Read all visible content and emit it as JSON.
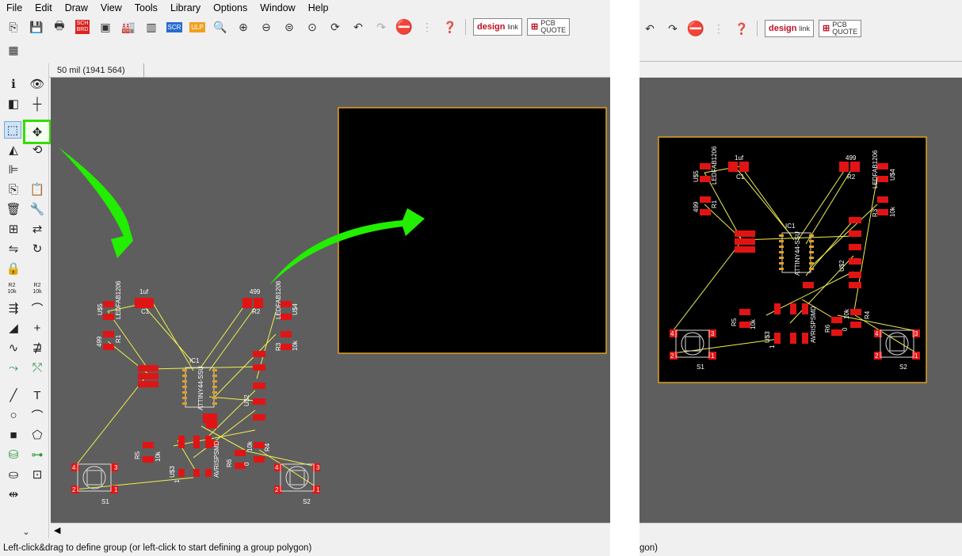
{
  "menu": [
    "File",
    "Edit",
    "Draw",
    "View",
    "Tools",
    "Library",
    "Options",
    "Window",
    "Help"
  ],
  "coordinate_readout": "50 mil (1941 564)",
  "status_text": "Left-click&drag to define group (or left-click to start defining a group polygon)",
  "status_text_right": "gon)",
  "logos": {
    "designlink": [
      "design",
      "link"
    ],
    "pcbquote": [
      "PCB",
      "QUOTE"
    ]
  },
  "toolbar_badges": {
    "sch_brd": "SCH BRD",
    "scr": "SCR",
    "ulp": "ULP"
  },
  "colors": {
    "canvas": "#5e5e5e",
    "board": "#000000",
    "outline": "#e0a020",
    "pad": "#e11414",
    "airwire": "#f0f050",
    "arrow": "#22ee00",
    "highlight": "#33dd00"
  },
  "side_labels": {
    "r2": "R2",
    "r2val": "10k"
  },
  "pcb": {
    "labels": {
      "u5": "U$5",
      "led1": "LEDFAB1206",
      "c1": "C1",
      "c1v": "1uf",
      "r1v": "499",
      "r1": "R1",
      "r2v": "499",
      "r2": "R2",
      "led2": "LEDFAB1206",
      "u4": "U$4",
      "r3": "R3",
      "r3v": "10k",
      "ic1": "IC1",
      "ic1part": "ATTINY44-SSU",
      "u2": "U$2",
      "r5": "R5",
      "r5v": "10k",
      "u3": "U$3",
      "one": "1",
      "avr": "AVRISPSMD",
      "r6": "R6",
      "r6v": "0",
      "r4v": "10k",
      "r4": "R4",
      "s1": "S1",
      "s2": "S2",
      "p4": "4",
      "p3": "3",
      "p2": "2",
      "p1": "1"
    }
  }
}
